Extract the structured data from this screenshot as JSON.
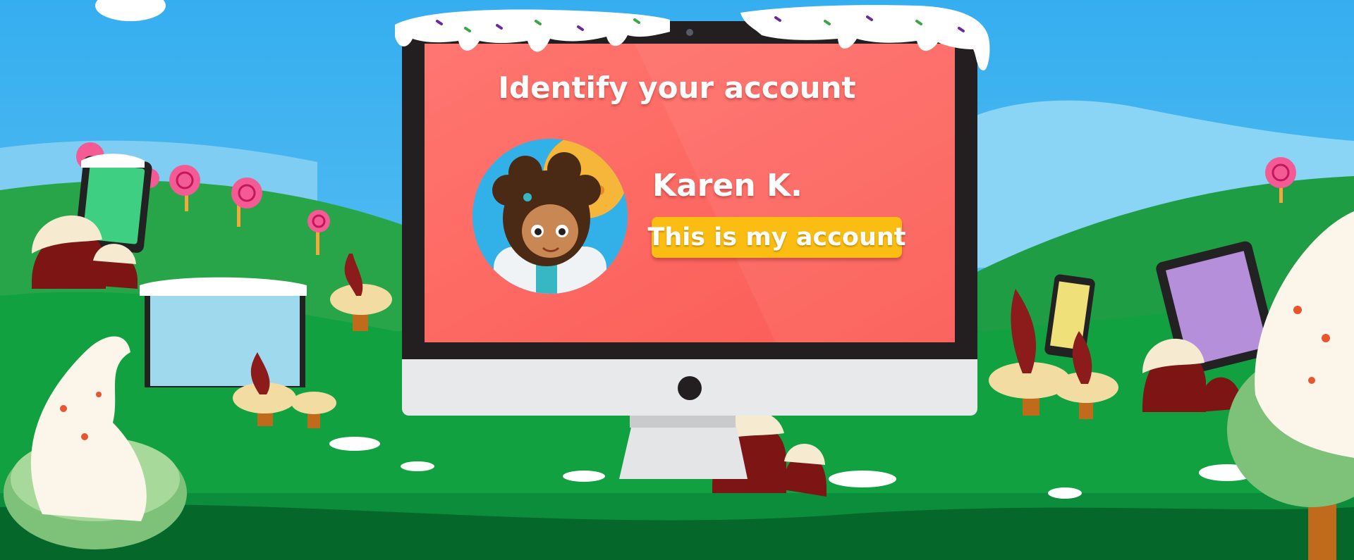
{
  "screen": {
    "title": "Identify your account"
  },
  "account": {
    "name": "Karen K.",
    "confirm_label": "This is my account"
  },
  "colors": {
    "sky": "#3bb3ea",
    "grass": "#0d9a3e",
    "screen": "#fe625c",
    "button": "#fbbd11",
    "monitor_frame": "#231f20"
  }
}
